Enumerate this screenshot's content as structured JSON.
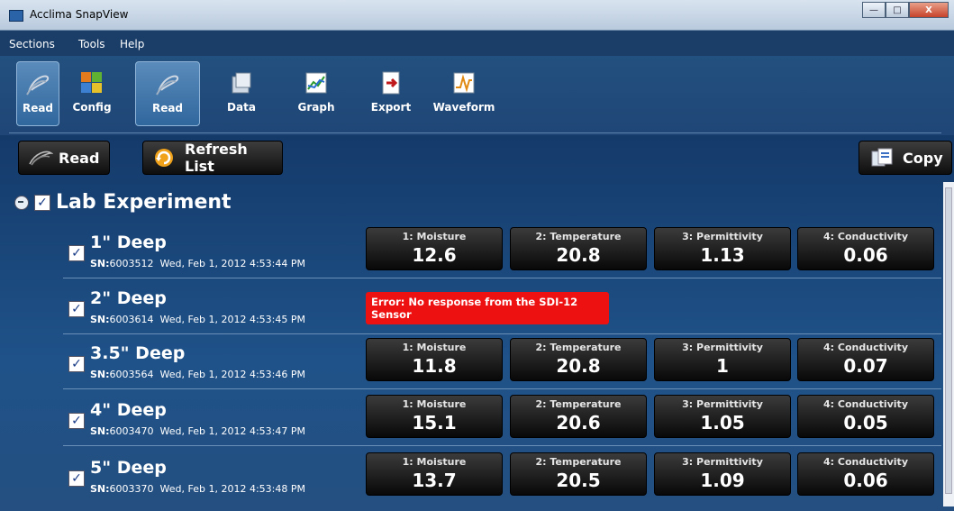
{
  "window": {
    "title": "Acclima SnapView"
  },
  "menu": [
    "Sections",
    "Tools",
    "Help"
  ],
  "ribbon": [
    {
      "label": "Read",
      "icon": "read-icon"
    },
    {
      "label": "Config",
      "icon": "puzzle-icon"
    },
    {
      "label": "Read",
      "icon": "read-icon"
    },
    {
      "label": "Data",
      "icon": "data-icon"
    },
    {
      "label": "Graph",
      "icon": "graph-icon"
    },
    {
      "label": "Export",
      "icon": "export-icon"
    },
    {
      "label": "Waveform",
      "icon": "waveform-icon"
    }
  ],
  "toolbar": {
    "read": "Read",
    "refresh": "Refresh List",
    "copy": "Copy"
  },
  "group": {
    "name": "Lab Experiment"
  },
  "sensors": [
    {
      "name": "1\" Deep",
      "sn_label": "SN:",
      "sn": "6003512",
      "time": "Wed, Feb 1, 2012 4:53:44 PM",
      "readings": [
        {
          "label": "1: Moisture",
          "value": "12.6"
        },
        {
          "label": "2: Temperature",
          "value": "20.8"
        },
        {
          "label": "3: Permittivity",
          "value": "1.13"
        },
        {
          "label": "4: Conductivity",
          "value": "0.06"
        }
      ]
    },
    {
      "name": "2\" Deep",
      "sn_label": "SN:",
      "sn": "6003614",
      "time": "Wed, Feb 1, 2012 4:53:45 PM",
      "error": "Error: No response from the SDI-12 Sensor"
    },
    {
      "name": "3.5\" Deep",
      "sn_label": "SN:",
      "sn": "6003564",
      "time": "Wed, Feb 1, 2012 4:53:46 PM",
      "readings": [
        {
          "label": "1: Moisture",
          "value": "11.8"
        },
        {
          "label": "2: Temperature",
          "value": "20.8"
        },
        {
          "label": "3: Permittivity",
          "value": "1"
        },
        {
          "label": "4: Conductivity",
          "value": "0.07"
        }
      ]
    },
    {
      "name": "4\" Deep",
      "sn_label": "SN:",
      "sn": "6003470",
      "time": "Wed, Feb 1, 2012 4:53:47 PM",
      "readings": [
        {
          "label": "1: Moisture",
          "value": "15.1"
        },
        {
          "label": "2: Temperature",
          "value": "20.6"
        },
        {
          "label": "3: Permittivity",
          "value": "1.05"
        },
        {
          "label": "4: Conductivity",
          "value": "0.05"
        }
      ]
    },
    {
      "name": "5\" Deep",
      "sn_label": "SN:",
      "sn": "6003370",
      "time": "Wed, Feb 1, 2012 4:53:48 PM",
      "readings": [
        {
          "label": "1: Moisture",
          "value": "13.7"
        },
        {
          "label": "2: Temperature",
          "value": "20.5"
        },
        {
          "label": "3: Permittivity",
          "value": "1.09"
        },
        {
          "label": "4: Conductivity",
          "value": "0.06"
        }
      ]
    }
  ]
}
